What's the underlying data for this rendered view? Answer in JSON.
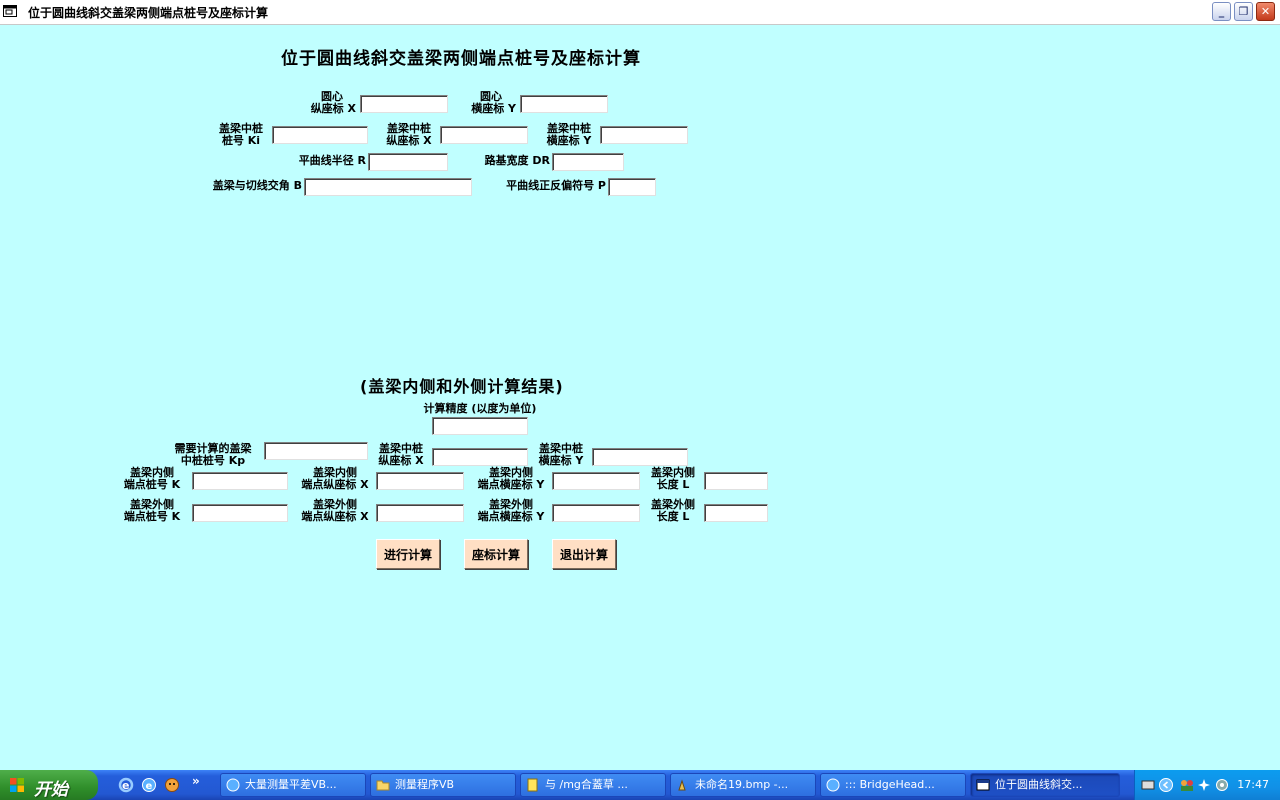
{
  "window": {
    "title": "位于圆曲线斜交盖梁两侧端点桩号及座标计算"
  },
  "form": {
    "heading": "位于圆曲线斜交盖梁两侧端点桩号及座标计算",
    "circle_x_label_1": "圆心",
    "circle_x_label_2": "纵座标 X",
    "circle_y_label_1": "圆心",
    "circle_y_label_2": "横座标 Y",
    "ki_label_1": "盖梁中桩",
    "ki_label_2": "桩号 Ki",
    "mid_x_label_1": "盖梁中桩",
    "mid_x_label_2": "纵座标 X",
    "mid_y_label_1": "盖梁中桩",
    "mid_y_label_2": "横座标 Y",
    "radius_label": "平曲线半径 R",
    "width_label": "路基宽度 DR",
    "angle_label": "盖梁与切线交角 B",
    "sign_label": "平曲线正反偏符号 P",
    "results_heading": "(盖梁内侧和外侧计算结果)",
    "precision_label": "计算精度 (以度为单位)",
    "kp_label_1": "需要计算的盖梁",
    "kp_label_2": "中桩桩号 Kp",
    "rx_label_1": "盖梁中桩",
    "rx_label_2": "纵座标 X",
    "ry_label_1": "盖梁中桩",
    "ry_label_2": "横座标 Y",
    "in_k_label_1": "盖梁内侧",
    "in_k_label_2": "端点桩号 K",
    "in_x_label_1": "盖梁内侧",
    "in_x_label_2": "端点纵座标 X",
    "in_y_label_1": "盖梁内侧",
    "in_y_label_2": "端点横座标 Y",
    "in_l_label_1": "盖梁内侧",
    "in_l_label_2": "长度  L",
    "out_k_label_1": "盖梁外侧",
    "out_k_label_2": "端点桩号 K",
    "out_x_label_1": "盖梁外侧",
    "out_x_label_2": "端点纵座标 X",
    "out_y_label_1": "盖梁外侧",
    "out_y_label_2": "端点横座标 Y",
    "out_l_label_1": "盖梁外侧",
    "out_l_label_2": "长度  L",
    "btn_compute": "进行计算",
    "btn_coord": "座标计算",
    "btn_exit": "退出计算"
  },
  "taskbar": {
    "start_label": "开始",
    "tasks": [
      "大量测量平差VB...",
      "测量程序VB",
      "与 /mg合蓋草 ...",
      "未命名19.bmp -...",
      "::: BridgeHead...",
      "位于圆曲线斜交..."
    ],
    "clock": "17:47"
  }
}
